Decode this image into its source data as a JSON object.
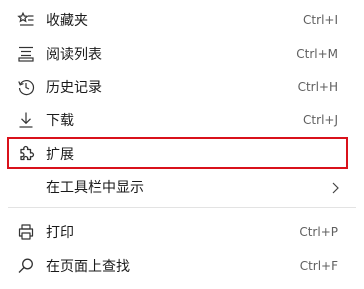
{
  "menu": {
    "items": [
      {
        "label": "收藏夹",
        "shortcut": "Ctrl+I",
        "icon": "star-list-icon"
      },
      {
        "label": "阅读列表",
        "shortcut": "Ctrl+M",
        "icon": "reading-list-icon"
      },
      {
        "label": "历史记录",
        "shortcut": "Ctrl+H",
        "icon": "history-icon"
      },
      {
        "label": "下载",
        "shortcut": "Ctrl+J",
        "icon": "download-icon"
      },
      {
        "label": "扩展",
        "shortcut": "",
        "icon": "puzzle-icon"
      },
      {
        "label": "在工具栏中显示",
        "shortcut": "",
        "icon": "chevron-right-icon"
      },
      {
        "label": "打印",
        "shortcut": "Ctrl+P",
        "icon": "printer-icon"
      },
      {
        "label": "在页面上查找",
        "shortcut": "Ctrl+F",
        "icon": "search-icon"
      }
    ]
  },
  "colors": {
    "highlight_border": "#d9111b",
    "text": "#1a1a1a",
    "shortcut_text": "#5f5f5f",
    "divider": "#e3e3e3"
  }
}
